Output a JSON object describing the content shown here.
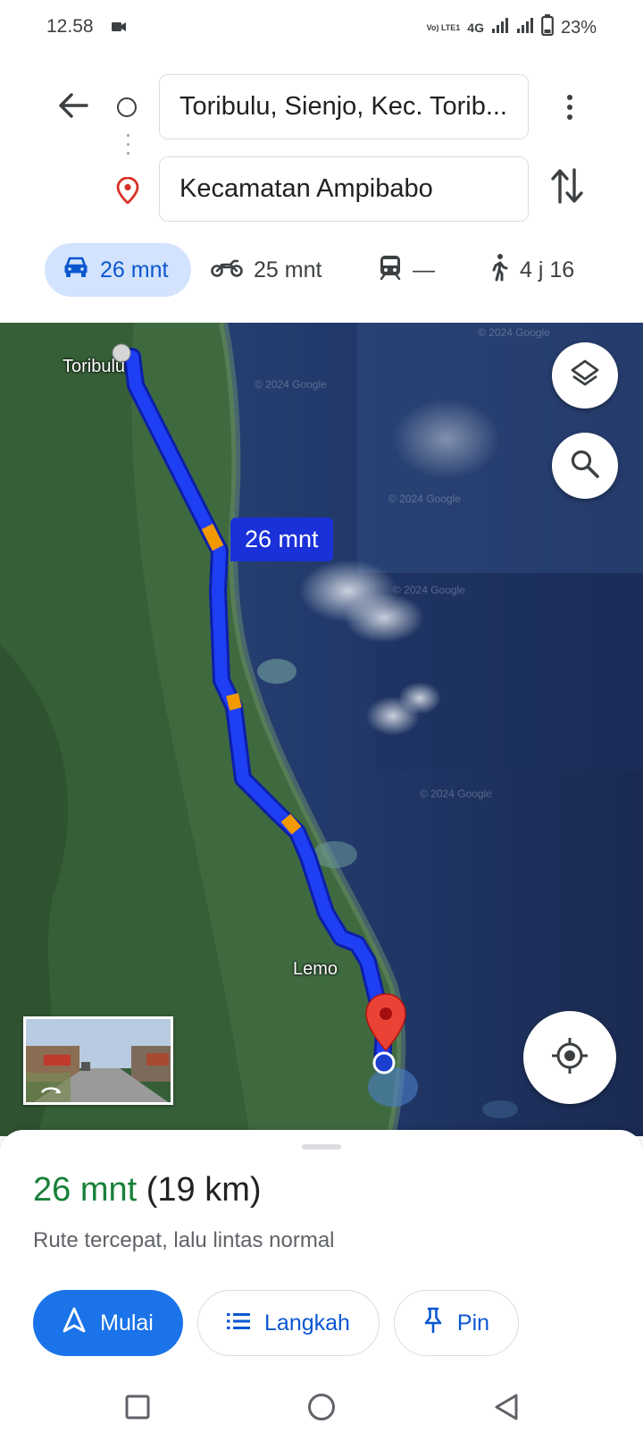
{
  "status_bar": {
    "time": "12.58",
    "network_label": "4G",
    "volte_label": "Vo) LTE1",
    "battery": "23%"
  },
  "search": {
    "from": "Toribulu, Sienjo, Kec. Torib...",
    "to": "Kecamatan Ampibabo"
  },
  "modes": {
    "drive": "26 mnt",
    "motorcycle": "25 mnt",
    "transit": "—",
    "walk": "4 j 16"
  },
  "map": {
    "place_toribulu": "Toribulu",
    "place_lemo": "Lemo",
    "route_bubble": "26 mnt",
    "watermark": "© 2024 Google",
    "route_color": "#1a31d9",
    "traffic_color": "#f29900",
    "destination_pin_color": "#ea4335"
  },
  "sheet": {
    "duration": "26 mnt",
    "distance": "(19 km)",
    "description": "Rute tercepat, lalu lintas normal",
    "start_label": "Mulai",
    "steps_label": "Langkah",
    "pin_label": "Pin",
    "duration_color": "#188038",
    "accent_color": "#1a73e8"
  },
  "icons": {
    "back": "arrow-back-icon",
    "origin": "origin-circle-icon",
    "destination": "destination-pin-icon",
    "more": "more-vert-icon",
    "swap": "swap-vert-icon",
    "car": "car-icon",
    "motorcycle": "motorcycle-icon",
    "transit": "train-icon",
    "walk": "walk-icon",
    "layers": "layers-icon",
    "search": "search-icon",
    "locate": "my-location-icon",
    "navigation": "navigation-arrow-icon",
    "list": "list-icon",
    "pin": "push-pin-icon"
  }
}
